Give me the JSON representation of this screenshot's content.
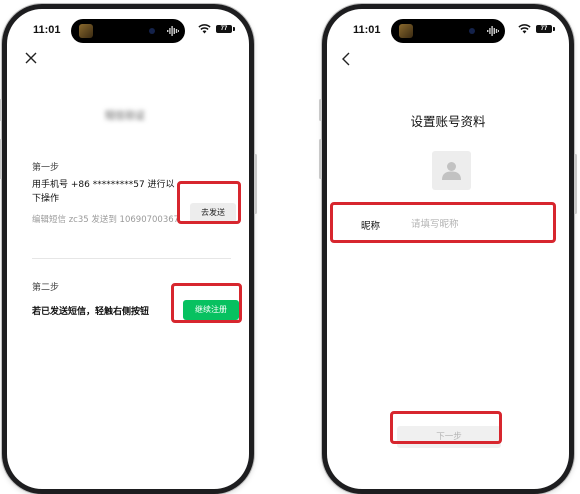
{
  "status_bar": {
    "time": "11:01",
    "battery": "77"
  },
  "screen_verify": {
    "title_blurred": "短信验证",
    "step1_label": "第一步",
    "step1_instruction": "用手机号 +86 *********57 进行以下操作",
    "step1_hint": "编辑短信 zc35 发送到 10690700367",
    "send_button": "去发送",
    "step2_label": "第二步",
    "step2_instruction": "若已发送短信，轻触右侧按钮",
    "register_button": "继续注册"
  },
  "screen_profile": {
    "title": "设置账号资料",
    "nickname_label": "昵称",
    "nickname_value": "",
    "nickname_placeholder": "请填写昵称",
    "next_button": "下一步"
  },
  "icons": {
    "close": "close-icon",
    "back": "back-arrow-icon",
    "wifi": "wifi-icon",
    "battery": "battery-icon",
    "avatar": "user-avatar-icon"
  },
  "colors": {
    "accent_green": "#07c160",
    "highlight_red": "#d7262e",
    "button_gray": "#ededed",
    "placeholder_gray": "#b3b3b3"
  }
}
